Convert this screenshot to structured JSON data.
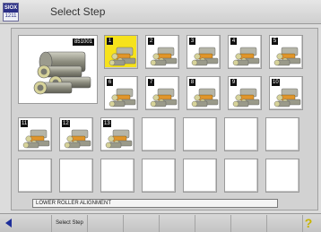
{
  "header": {
    "title": "Select Step",
    "logo_top": "SIOX",
    "logo_bottom": "1211"
  },
  "grid": {
    "main_cell": {
      "code": "851001"
    },
    "cells": [
      {
        "row": 0,
        "col": 0,
        "num": "1",
        "image": "rollers",
        "selected": true
      },
      {
        "row": 0,
        "col": 1,
        "num": "2",
        "image": "rollers",
        "selected": false
      },
      {
        "row": 0,
        "col": 2,
        "num": "3",
        "image": "rollers",
        "selected": false
      },
      {
        "row": 0,
        "col": 3,
        "num": "4",
        "image": "rollers",
        "selected": false
      },
      {
        "row": 0,
        "col": 4,
        "num": "5",
        "image": "rollers",
        "selected": false
      },
      {
        "row": 1,
        "col": 0,
        "num": "6",
        "image": "rollers",
        "selected": false
      },
      {
        "row": 1,
        "col": 1,
        "num": "7",
        "image": "rollers",
        "selected": false
      },
      {
        "row": 1,
        "col": 2,
        "num": "8",
        "image": "rollers",
        "selected": false
      },
      {
        "row": 1,
        "col": 3,
        "num": "9",
        "image": "rollers",
        "selected": false
      },
      {
        "row": 1,
        "col": 4,
        "num": "10",
        "image": "rollers",
        "selected": false
      },
      {
        "row": 2,
        "col": 0,
        "num": "11",
        "image": "rollers",
        "selected": false
      },
      {
        "row": 2,
        "col": 1,
        "num": "12",
        "image": "rollers",
        "selected": false
      },
      {
        "row": 2,
        "col": 2,
        "num": "13",
        "image": "rollers",
        "selected": false
      }
    ],
    "empty_cells": 11
  },
  "status": {
    "text": "LOWER ROLLER ALIGNMENT"
  },
  "softkeys": {
    "keys": [
      "",
      "Select Step",
      "",
      "",
      "",
      "",
      "",
      ""
    ],
    "back_icon": "back-arrow-icon",
    "help_icon": "help-icon"
  },
  "colors": {
    "selected": "#f6e21c",
    "roller_steel": "#9a9a8a",
    "roller_accent": "#e0952a"
  }
}
